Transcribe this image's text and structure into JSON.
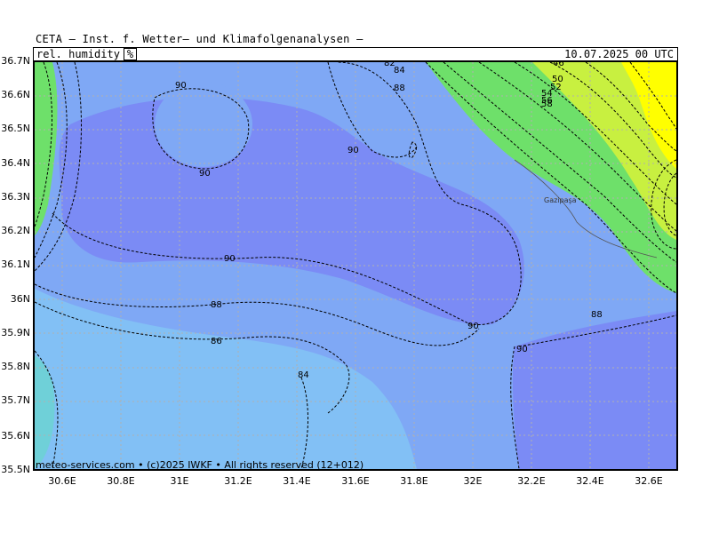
{
  "header": {
    "title": "CETA — Inst. f. Wetter— und Klimafolgenanalysen —",
    "parameter": "rel. humidity",
    "unit": "%",
    "datetime": "10.07.2025 00 UTC"
  },
  "map": {
    "place_label": "Gazipaşa",
    "lat_labels": [
      "36.7N",
      "36.6N",
      "36.5N",
      "36.4N",
      "36.3N",
      "36.2N",
      "36.1N",
      "36N",
      "35.9N",
      "35.8N",
      "35.7N",
      "35.6N",
      "35.5N"
    ],
    "lon_labels": [
      "30.6E",
      "30.8E",
      "31E",
      "31.2E",
      "31.4E",
      "31.6E",
      "31.8E",
      "32E",
      "32.2E",
      "32.4E",
      "32.6E"
    ],
    "contour_labels": [
      "90",
      "90",
      "90",
      "90",
      "90",
      "90",
      "88",
      "88",
      "86",
      "84",
      "88",
      "84",
      "82",
      "50",
      "52",
      "54",
      "56",
      "58",
      "46"
    ],
    "colors": {
      "very_humid": "#7b8bf5",
      "humid": "#7fa8f5",
      "moist": "#82c0f5",
      "teal": "#6fd0d8",
      "green": "#6ee06a",
      "yellow_green": "#c8f040",
      "yellow": "#ffff00"
    }
  },
  "footer": {
    "credit": "meteo-services.com • (c)2025 IWKF • All rights reserved (12+012)"
  }
}
